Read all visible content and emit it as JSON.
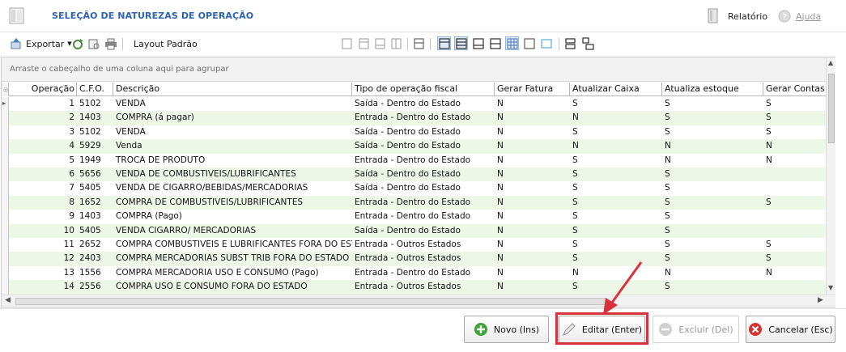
{
  "window": {
    "title": "SELEÇÃO DE NATUREZAS DE OPERAÇÃO",
    "report_label": "Relatório",
    "help_label": "Ajuda"
  },
  "toolbar": {
    "export_label": "Exportar",
    "layout_label": "Layout Padrão"
  },
  "grid": {
    "group_hint": "Arraste o cabeçalho de uma coluna aqui para agrupar",
    "columns": [
      "Operação",
      "C.F.O.",
      "Descrição",
      "Tipo de operação fiscal",
      "Gerar Fatura",
      "Atualizar Caixa",
      "Atualiza estoque",
      "Gerar Contas Pa"
    ],
    "rows": [
      [
        "1",
        "5102",
        "VENDA",
        "Saída - Dentro do Estado",
        "N",
        "S",
        "S",
        "S"
      ],
      [
        "2",
        "1403",
        "COMPRA (á pagar)",
        "Entrada - Dentro do Estado",
        "N",
        "N",
        "S",
        "S"
      ],
      [
        "3",
        "5102",
        "VENDA",
        "Saída - Dentro do Estado",
        "N",
        "S",
        "S",
        "S"
      ],
      [
        "4",
        "5929",
        "Venda",
        "Saída - Dentro do Estado",
        "N",
        "N",
        "N",
        "N"
      ],
      [
        "5",
        "1949",
        "TROCA DE PRODUTO",
        "Entrada - Dentro do Estado",
        "N",
        "S",
        "N",
        "N"
      ],
      [
        "6",
        "5656",
        "VENDA DE COMBUSTIVEIS/LUBRIFICANTES",
        "Saída - Dentro do Estado",
        "N",
        "S",
        "S",
        ""
      ],
      [
        "7",
        "5405",
        "VENDA DE CIGARRO/BEBIDAS/MERCADORIAS",
        "Saída - Dentro do Estado",
        "N",
        "S",
        "S",
        ""
      ],
      [
        "8",
        "1652",
        "COMPRA DE COMBUSTIVEIS/LUBRIFICANTES",
        "Entrada - Dentro do Estado",
        "N",
        "S",
        "S",
        "S"
      ],
      [
        "9",
        "1403",
        "COMPRA (Pago)",
        "Entrada - Dentro do Estado",
        "N",
        "S",
        "S",
        ""
      ],
      [
        "10",
        "5405",
        "VENDA CIGARRO/ MERCADORIAS",
        "Saída - Dentro do Estado",
        "N",
        "S",
        "S",
        ""
      ],
      [
        "11",
        "2652",
        "COMPRA COMBUSTIVEIS E LUBRIFICANTES FORA DO ESTADO",
        "Entrada - Outros Estados",
        "N",
        "S",
        "S",
        "S"
      ],
      [
        "12",
        "2403",
        "COMPRA MERCADORIAS SUBST TRIB FORA DO ESTADO",
        "Entrada - Outros Estados",
        "N",
        "S",
        "S",
        "S"
      ],
      [
        "13",
        "1556",
        "COMPRA MERCADORIA USO E CONSUMO (Pago)",
        "Entrada - Dentro do Estado",
        "N",
        "N",
        "N",
        "N"
      ],
      [
        "14",
        "2556",
        "COMPRA USO E CONSUMO FORA DO ESTADO",
        "Entrada - Outros Estados",
        "N",
        "S",
        "S",
        ""
      ]
    ]
  },
  "actions": {
    "new_label": "Novo (Ins)",
    "edit_label": "Editar (Enter)",
    "delete_label": "Excluir (Del)",
    "cancel_label": "Cancelar (Esc)"
  },
  "colors": {
    "title": "#2e63b5",
    "row_alt": "#eef6e8",
    "highlight": "#d8323c",
    "new_icon": "#3fa33a",
    "cancel_icon": "#d8332c"
  },
  "icons": [
    "window-icon",
    "report-icon",
    "help-icon",
    "export-icon",
    "refresh-icon",
    "print-icon",
    "add-icon",
    "edit-icon",
    "delete-icon",
    "cancel-icon",
    "annotation-arrow"
  ]
}
